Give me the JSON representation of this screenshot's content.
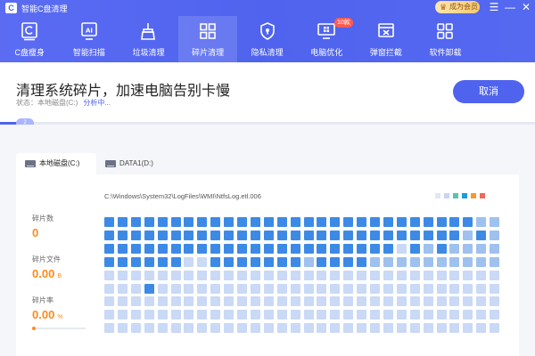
{
  "app": {
    "title": "智能C盘清理",
    "logo_letter": "C",
    "vip_label": "成为会员",
    "controls": {
      "menu": "☰",
      "minimize": "—",
      "close": "✕"
    }
  },
  "nav": {
    "items": [
      {
        "label": "C盘瘦身",
        "icon": "c-drive-slim-icon",
        "active": false
      },
      {
        "label": "智能扫描",
        "icon": "ai-scan-icon",
        "active": false
      },
      {
        "label": "垃圾清理",
        "icon": "broom-icon",
        "active": false
      },
      {
        "label": "碎片清理",
        "icon": "fragment-grid-icon",
        "active": true
      },
      {
        "label": "隐私清理",
        "icon": "privacy-shield-icon",
        "active": false
      },
      {
        "label": "电脑优化",
        "icon": "monitor-optimize-icon",
        "active": false,
        "badge": "10款"
      },
      {
        "label": "弹窗拦截",
        "icon": "popup-block-icon",
        "active": false
      },
      {
        "label": "软件卸载",
        "icon": "apps-uninstall-icon",
        "active": false
      }
    ]
  },
  "status": {
    "headline": "清理系统碎片，加速电脑告别卡慢",
    "state_label": "状态：本地磁盘(C:)",
    "state_action": "分析中...",
    "cancel_label": "取消",
    "progress": 0.05,
    "progress_badge": "2"
  },
  "tabs": [
    {
      "label": "本地磁盘(C:)",
      "active": true
    },
    {
      "label": "DATA1(D:)",
      "active": false
    }
  ],
  "panel": {
    "current_path": "C:\\Windows\\System32\\LogFiles\\WMI\\NtfsLog.etl.006",
    "legend_colors": [
      "#dfe6f4",
      "#c7d7f2",
      "#58c3b3",
      "#1e9bd8",
      "#f29a2e",
      "#ef6a5a"
    ],
    "stats": [
      {
        "label": "碎片数",
        "value": "0",
        "unit": ""
      },
      {
        "label": "碎片文件",
        "value": "0.00",
        "unit": "B"
      },
      {
        "label": "碎片率",
        "value": "0.00",
        "unit": "%"
      }
    ]
  },
  "grid": {
    "columns": 30,
    "rows": 9,
    "cells": [
      "333333333333333333333333333322",
      "333333333333333333333333333232",
      "333333333333333333333313232222",
      "333333113333333233332222222222",
      "111111111111111111111111111111",
      "111311111111111111111111111111",
      "111111111111111111111111111111",
      "111111111111111111111111111111",
      "111111111111111111111111111111"
    ],
    "colors": {
      "1": "#c9d9f6",
      "2": "#9fc1ef",
      "3": "#3d8ae6"
    }
  }
}
